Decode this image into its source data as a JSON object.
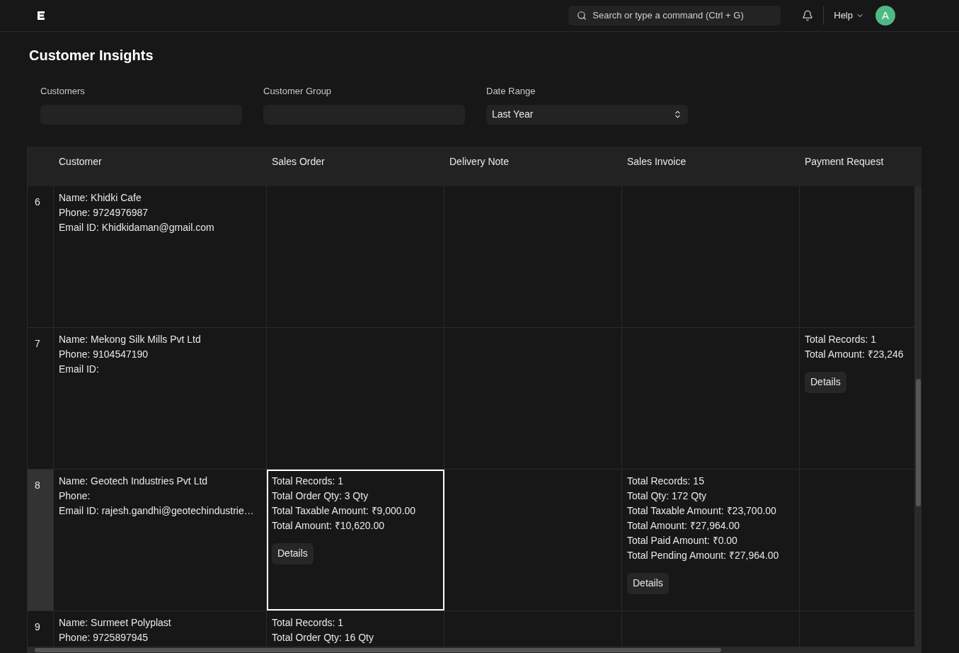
{
  "navbar": {
    "search": {
      "placeholder": "Search or type a command (Ctrl + G)"
    },
    "help": "Help",
    "avatar": "A"
  },
  "title": "Customer Insights",
  "filters": [
    {
      "label": "Customers",
      "kind": "text"
    },
    {
      "label": "Customer Group",
      "kind": "text"
    },
    {
      "label": "Date Range",
      "kind": "select",
      "value": "Last Year"
    }
  ],
  "table": {
    "columns": [
      "",
      "Customer",
      "Sales Order",
      "Delivery Note",
      "Sales Invoice",
      "Payment Request"
    ],
    "rows": [
      {
        "selected": false,
        "cells": [
          {
            "kind": "index",
            "text": "6",
            "focused": false
          },
          {
            "kind": "lines",
            "focused": false,
            "lines": [
              "Name: Khidki Cafe",
              "Phone: 9724976987",
              "Email ID: Khidkidaman@gmail.com"
            ]
          },
          {
            "kind": "lines",
            "focused": false
          },
          {
            "kind": "lines",
            "focused": false
          },
          {
            "kind": "lines",
            "focused": false
          },
          {
            "kind": "lines",
            "focused": false
          }
        ]
      },
      {
        "selected": false,
        "cells": [
          {
            "kind": "index",
            "text": "7",
            "focused": false
          },
          {
            "kind": "lines",
            "focused": false,
            "lines": [
              "Name: Mekong Silk Mills Pvt Ltd",
              "Phone: 9104547190",
              "Email ID:"
            ]
          },
          {
            "kind": "lines",
            "focused": false
          },
          {
            "kind": "lines",
            "focused": false
          },
          {
            "kind": "lines",
            "focused": false
          },
          {
            "kind": "lines",
            "focused": false,
            "lines": [
              "Total Records: 1",
              "Total Amount: ₹23,246"
            ],
            "button": "Details"
          }
        ]
      },
      {
        "selected": true,
        "cells": [
          {
            "kind": "index",
            "text": "8",
            "focused": false
          },
          {
            "kind": "lines",
            "focused": false,
            "lines": [
              "Name: Geotech Industries Pvt Ltd",
              "Phone:",
              "Email ID: rajesh.gandhi@geotechindustrie…"
            ]
          },
          {
            "kind": "lines",
            "focused": true,
            "lines": [
              "Total Records: 1",
              "Total Order Qty: 3 Qty",
              "Total Taxable Amount: ₹9,000.00",
              "Total Amount: ₹10,620.00"
            ],
            "button": "Details"
          },
          {
            "kind": "lines",
            "focused": false
          },
          {
            "kind": "lines",
            "focused": false,
            "lines": [
              "Total Records: 15",
              "Total Qty: 172 Qty",
              "Total Taxable Amount: ₹23,700.00",
              "Total Amount: ₹27,964.00",
              "Total Paid Amount: ₹0.00",
              "Total Pending Amount: ₹27,964.00"
            ],
            "button": "Details"
          },
          {
            "kind": "lines",
            "focused": false
          }
        ]
      },
      {
        "selected": false,
        "cells": [
          {
            "kind": "index",
            "text": "9",
            "focused": false
          },
          {
            "kind": "lines",
            "focused": false,
            "lines": [
              "Name: Surmeet Polyplast",
              "Phone: 9725897945"
            ]
          },
          {
            "kind": "lines",
            "focused": false,
            "lines": [
              "Total Records: 1",
              "Total Order Qty: 16 Qty"
            ]
          },
          {
            "kind": "lines",
            "focused": false
          },
          {
            "kind": "lines",
            "focused": false
          },
          {
            "kind": "lines",
            "focused": false
          }
        ]
      }
    ]
  }
}
